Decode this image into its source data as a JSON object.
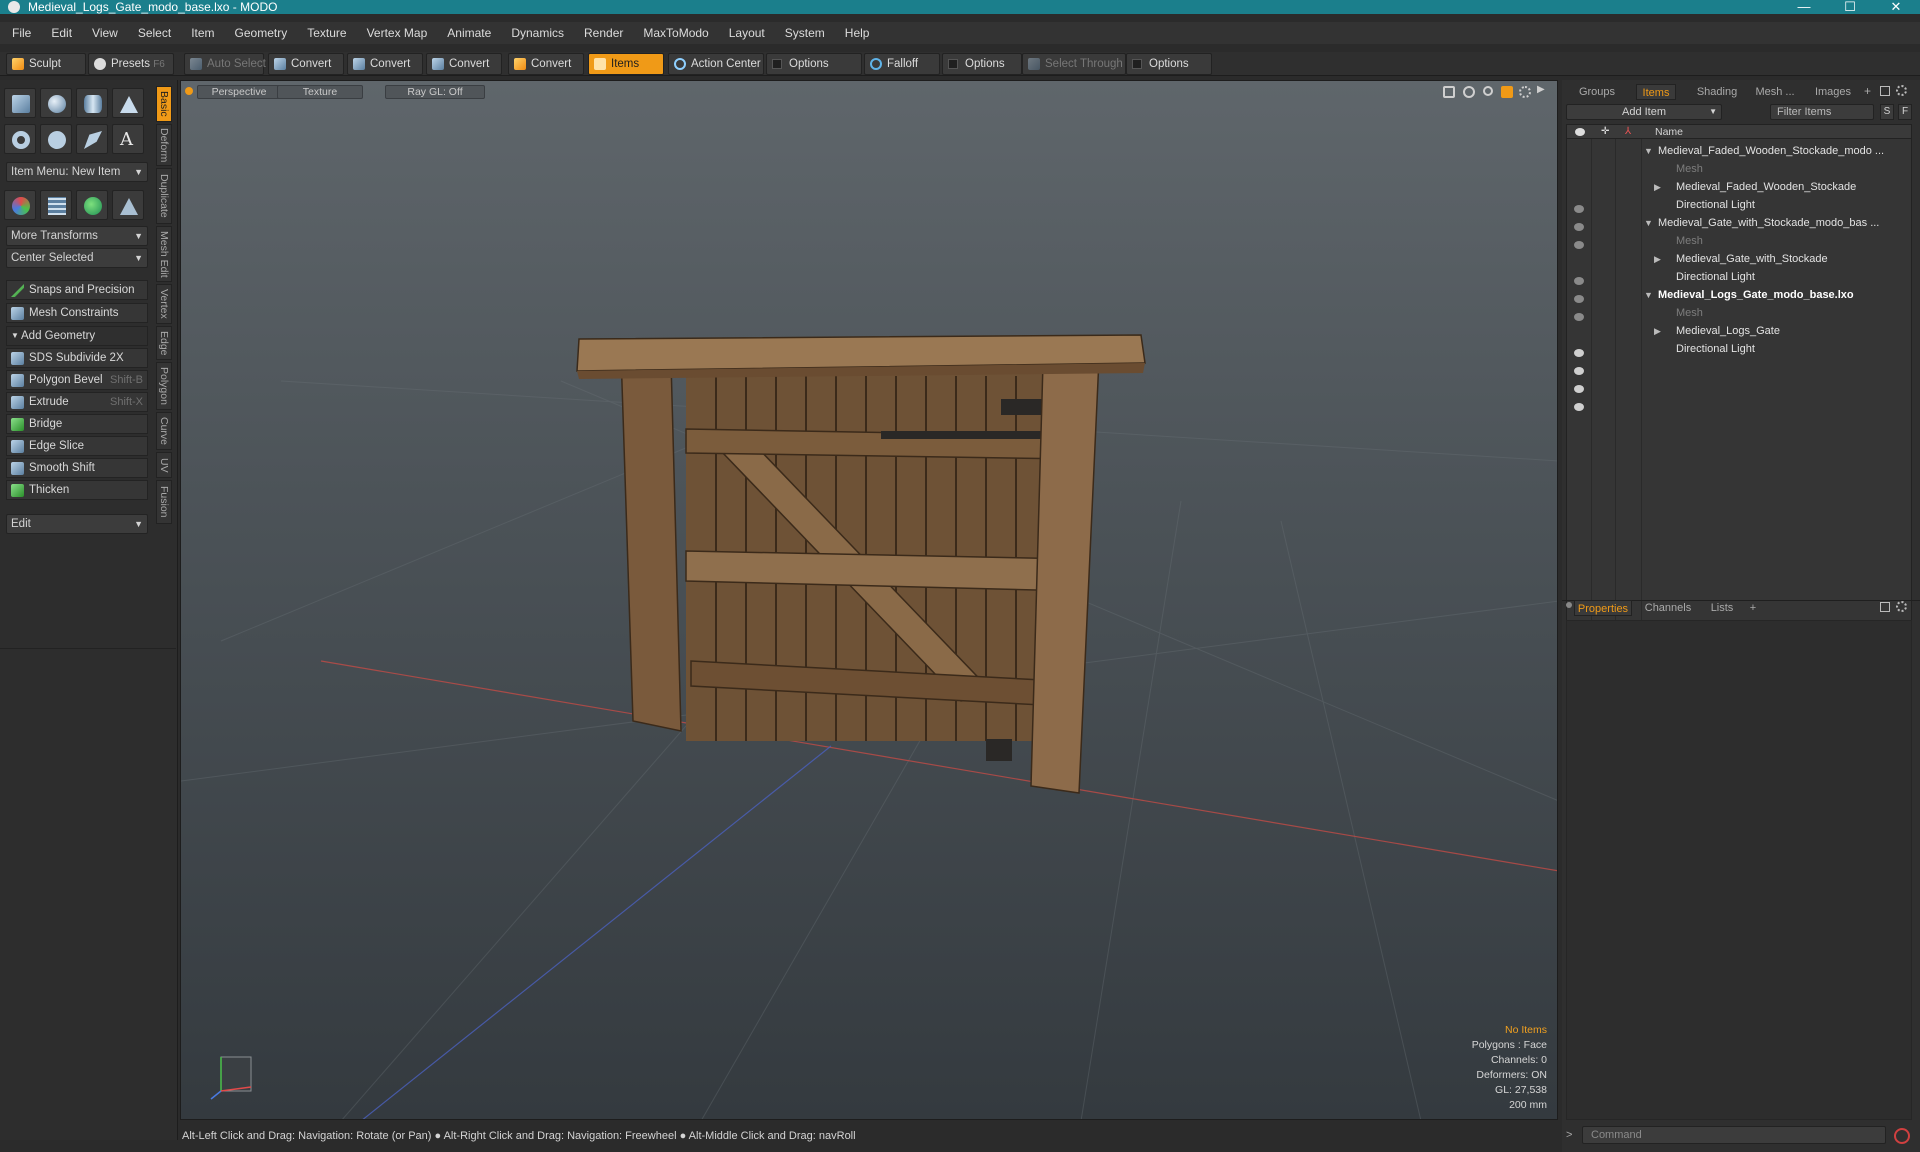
{
  "window": {
    "title": "Medieval_Logs_Gate_modo_base.lxo - MODO",
    "minimize": "—",
    "maximize": "☐",
    "close": "✕"
  },
  "menu": [
    "File",
    "Edit",
    "View",
    "Select",
    "Item",
    "Geometry",
    "Texture",
    "Vertex Map",
    "Animate",
    "Dynamics",
    "Render",
    "MaxToModo",
    "Layout",
    "System",
    "Help"
  ],
  "toolbar": {
    "sculpt": "Sculpt",
    "presets": "Presets",
    "presets_key": "F6",
    "auto_select": "Auto Select",
    "convert1": "Convert",
    "convert2": "Convert",
    "convert3": "Convert",
    "convert4": "Convert",
    "items": "Items",
    "action_center": "Action Center",
    "options1": "Options",
    "falloff": "Falloff",
    "options2": "Options",
    "select_through": "Select Through",
    "options3": "Options"
  },
  "left": {
    "item_menu": "Item Menu: New Item",
    "more_transforms": "More Transforms",
    "center_selected": "Center Selected",
    "snaps": "Snaps and Precision",
    "mesh_constraints": "Mesh Constraints",
    "add_geometry": "Add Geometry",
    "tools": [
      {
        "label": "SDS Subdivide 2X",
        "shortcut": ""
      },
      {
        "label": "Polygon Bevel",
        "shortcut": "Shift-B"
      },
      {
        "label": "Extrude",
        "shortcut": "Shift-X"
      },
      {
        "label": "Bridge",
        "shortcut": ""
      },
      {
        "label": "Edge Slice",
        "shortcut": ""
      },
      {
        "label": "Smooth Shift",
        "shortcut": ""
      },
      {
        "label": "Thicken",
        "shortcut": ""
      }
    ],
    "edit": "Edit",
    "vtabs": [
      "Basic",
      "Deform",
      "Duplicate",
      "Mesh Edit",
      "Vertex",
      "Edge",
      "Polygon",
      "Curve",
      "UV",
      "Fusion"
    ]
  },
  "viewport": {
    "perspective": "Perspective",
    "texture": "Texture",
    "raygl": "Ray GL: Off",
    "info": {
      "no_items": "No Items",
      "polygons": "Polygons : Face",
      "channels": "Channels: 0",
      "deformers": "Deformers: ON",
      "gl": "GL: 27,538",
      "scale": "200 mm"
    }
  },
  "status": "Alt-Left Click and Drag: Navigation: Rotate (or Pan) ● Alt-Right Click and Drag: Navigation: Freewheel ● Alt-Middle Click and Drag: navRoll",
  "right": {
    "tabs": [
      "Groups",
      "Items",
      "Shading",
      "Mesh ...",
      "Images"
    ],
    "add_item": "Add Item",
    "filter": "Filter Items",
    "s_btn": "S",
    "f_btn": "F",
    "col_name": "Name",
    "tree": [
      "Medieval_Faded_Wooden_Stockade_modo ...",
      "Mesh",
      "Medieval_Faded_Wooden_Stockade",
      "Directional Light",
      "Medieval_Gate_with_Stockade_modo_bas ...",
      "Mesh",
      "Medieval_Gate_with_Stockade",
      "Directional Light",
      "Medieval_Logs_Gate_modo_base.lxo",
      "Mesh",
      "Medieval_Logs_Gate",
      "Directional Light"
    ],
    "props_tabs": [
      "Properties",
      "Channels",
      "Lists",
      "+"
    ],
    "command": "Command"
  },
  "colors": {
    "accent": "#f09a17",
    "titlebar": "#1b7f8c"
  }
}
